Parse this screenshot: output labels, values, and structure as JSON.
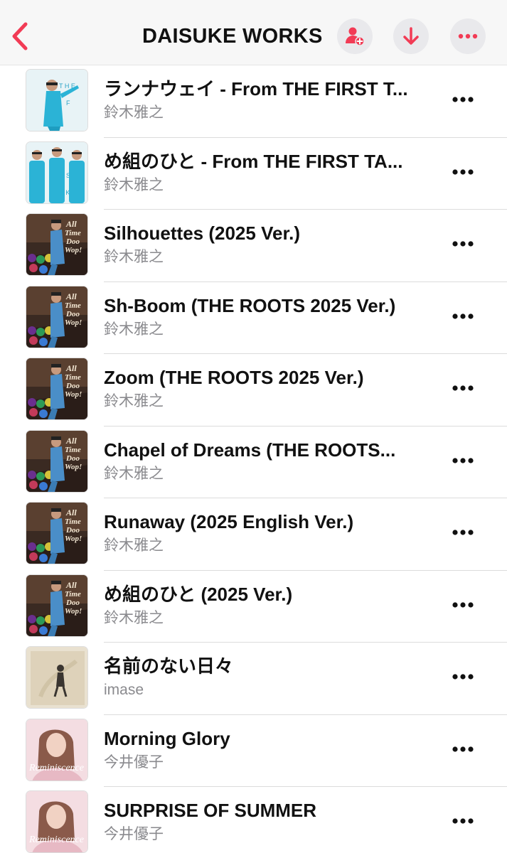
{
  "header": {
    "title": "DAISUKE WORKS",
    "accent_color": "#f23b55",
    "icons": [
      "chevron-left-icon",
      "person-add-icon",
      "download-arrow-icon",
      "ellipsis-icon"
    ]
  },
  "songs": [
    {
      "title": "ランナウェイ - From THE FIRST T...",
      "artist": "鈴木雅之",
      "art": "cyan-suit"
    },
    {
      "title": "め組のひと - From THE FIRST TA...",
      "artist": "鈴木雅之",
      "art": "cyan-trio"
    },
    {
      "title": "Silhouettes (2025 Ver.)",
      "artist": "鈴木雅之",
      "art": "doo-wop"
    },
    {
      "title": "Sh-Boom (THE ROOTS 2025 Ver.)",
      "artist": "鈴木雅之",
      "art": "doo-wop"
    },
    {
      "title": "Zoom (THE ROOTS 2025 Ver.)",
      "artist": "鈴木雅之",
      "art": "doo-wop"
    },
    {
      "title": "Chapel of Dreams (THE ROOTS...",
      "artist": "鈴木雅之",
      "art": "doo-wop"
    },
    {
      "title": "Runaway (2025 English Ver.)",
      "artist": "鈴木雅之",
      "art": "doo-wop"
    },
    {
      "title": "め組のひと (2025 Ver.)",
      "artist": "鈴木雅之",
      "art": "doo-wop"
    },
    {
      "title": "名前のない日々",
      "artist": "imase",
      "art": "beige-figure"
    },
    {
      "title": "Morning Glory",
      "artist": "今井優子",
      "art": "pink-portrait"
    },
    {
      "title": "SURPRISE OF SUMMER",
      "artist": "今井優子",
      "art": "pink-portrait"
    }
  ]
}
